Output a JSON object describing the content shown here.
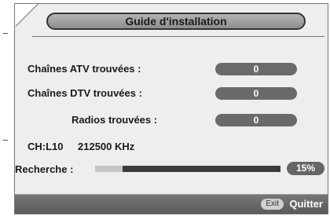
{
  "title": "Guide d'installation",
  "rows": [
    {
      "label": "Chaînes ATV trouvées :",
      "value": "0"
    },
    {
      "label": "Chaînes DTV trouvées :",
      "value": "0"
    },
    {
      "label": "Radios trouvées :",
      "value": "0"
    }
  ],
  "channel": "CH:L10",
  "frequency": "212500 KHz",
  "search": {
    "label": "Recherche :",
    "percent_text": "15%",
    "progress": 0.15
  },
  "footer": {
    "exit_key": "Exit",
    "quit_label": "Quitter"
  },
  "colors": {
    "panel": "#eeeeee",
    "pill": "#6a6a6a",
    "footer": "#666666"
  }
}
